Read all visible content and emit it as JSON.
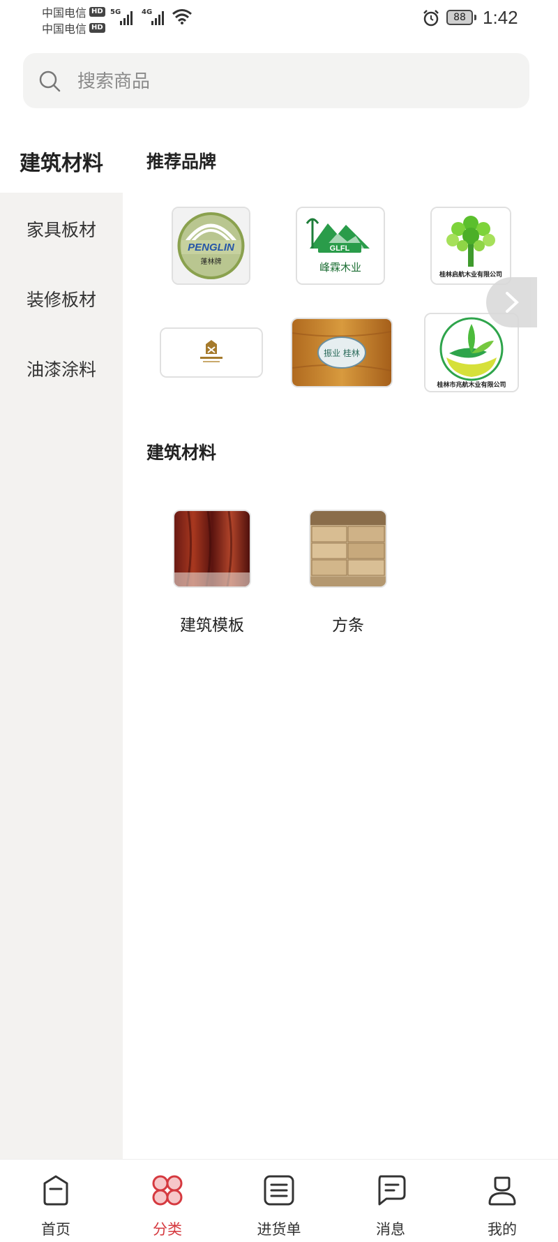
{
  "status_bar": {
    "carrier1": "中国电信",
    "carrier2": "中国电信",
    "hd": "HD",
    "net1": "5G",
    "net2": "4G",
    "battery": "88",
    "time": "1:42"
  },
  "search": {
    "placeholder": "搜索商品"
  },
  "sidebar": {
    "active": "建筑材料",
    "items": [
      {
        "label": "家具板材"
      },
      {
        "label": "装修板材"
      },
      {
        "label": "油漆涂料"
      }
    ]
  },
  "brands": {
    "title": "推荐品牌",
    "logos": [
      {
        "name": "penglin-logo",
        "text": "PENGLIN",
        "sub": "蓬林牌"
      },
      {
        "name": "glfl-logo",
        "text": "GLFL",
        "sub": "峰霖木业"
      },
      {
        "name": "qihang-logo",
        "text": "桂林启航木业有限公司"
      },
      {
        "name": "brand4-logo"
      },
      {
        "name": "brand5-logo",
        "text": "振业 桂林"
      },
      {
        "name": "zhaohang-logo",
        "text": "桂林市兆航木业有限公司"
      }
    ]
  },
  "category": {
    "title": "建筑材料",
    "items": [
      {
        "label": "建筑模板"
      },
      {
        "label": "方条"
      }
    ]
  },
  "bottom_nav": {
    "items": [
      {
        "label": "首页"
      },
      {
        "label": "分类"
      },
      {
        "label": "进货单"
      },
      {
        "label": "消息"
      },
      {
        "label": "我的"
      }
    ],
    "accent": "#d5393f"
  }
}
